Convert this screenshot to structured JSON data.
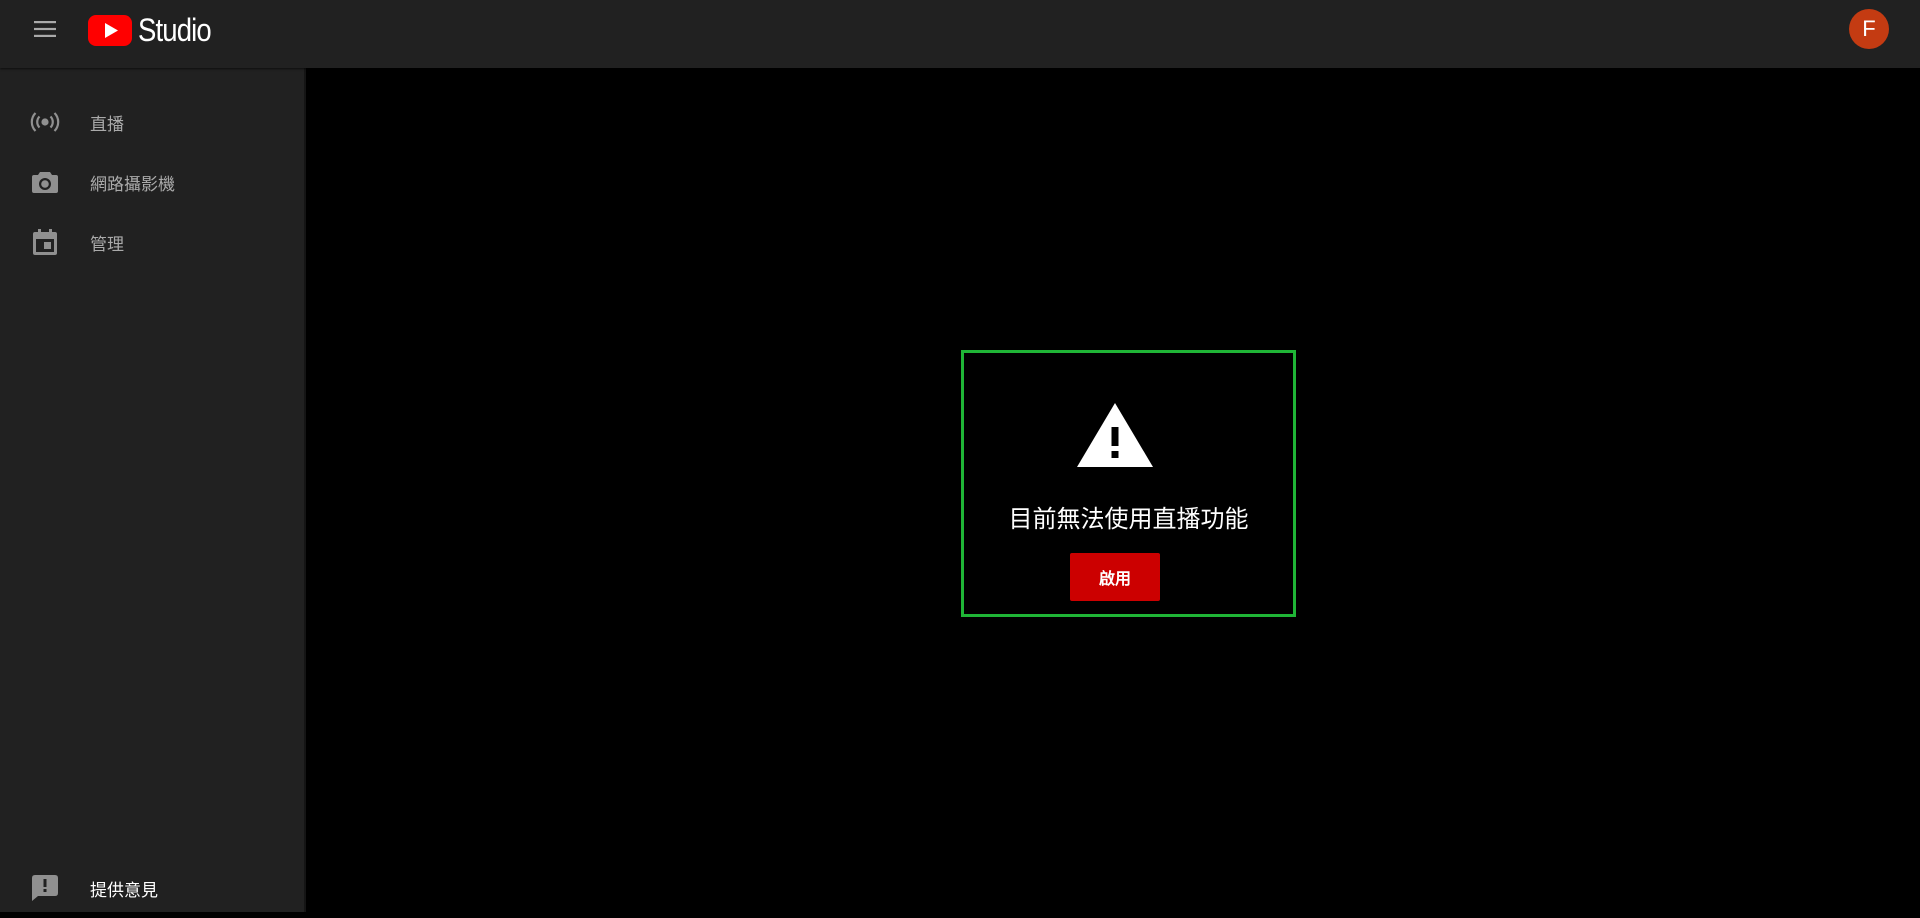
{
  "header": {
    "menu_icon": "hamburger-menu-icon",
    "logo_icon": "youtube-play-logo-icon",
    "logo_text": "Studio",
    "avatar_letter": "F",
    "avatar_color": "#c43b12",
    "logo_red": "#ff0000"
  },
  "sidebar": {
    "items": [
      {
        "label": "直播",
        "icon": "live-broadcast-icon"
      },
      {
        "label": "網路攝影機",
        "icon": "camera-icon"
      },
      {
        "label": "管理",
        "icon": "calendar-icon"
      }
    ],
    "feedback": {
      "label": "提供意見",
      "icon": "feedback-icon"
    }
  },
  "main": {
    "notice": {
      "icon": "warning-icon",
      "message": "目前無法使用直播功能",
      "button_label": "啟用",
      "button_color": "#cc0000",
      "border_color": "#1fb536"
    }
  }
}
